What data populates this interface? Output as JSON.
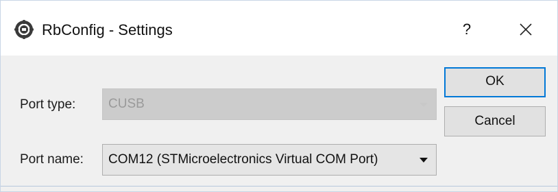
{
  "window": {
    "title": "RbConfig - Settings",
    "app_icon": "rbconfig-app-icon",
    "help_label": "?",
    "close_icon": "close-icon"
  },
  "form": {
    "port_type": {
      "label": "Port type:",
      "value": "CUSB",
      "enabled": false
    },
    "port_name": {
      "label": "Port name:",
      "value": "COM12 (STMicroelectronics Virtual COM Port)",
      "enabled": true
    }
  },
  "buttons": {
    "ok_label": "OK",
    "cancel_label": "Cancel"
  },
  "colors": {
    "accent": "#0078d7",
    "dialog_bg": "#f0f0f0",
    "disabled_text": "#9a9a9a"
  }
}
